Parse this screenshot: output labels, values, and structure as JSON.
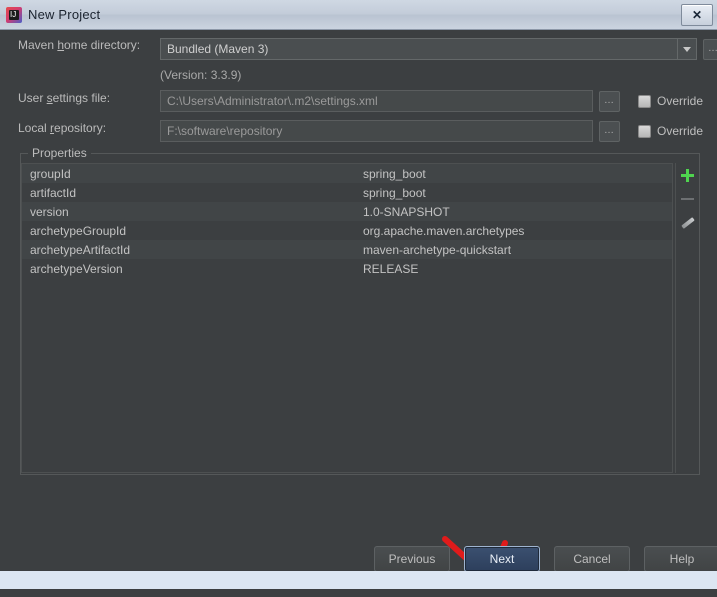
{
  "window": {
    "title": "New Project",
    "app_icon": "intellij-idea-icon",
    "close_label": "✕"
  },
  "form": {
    "maven_home": {
      "label_pre": "Maven ",
      "label_mnemonic": "h",
      "label_post": "ome directory:",
      "value": "Bundled (Maven 3)",
      "browse_label": "…",
      "version_note": "(Version: 3.3.9)"
    },
    "user_settings": {
      "label_pre": "User ",
      "label_mnemonic": "s",
      "label_post": "ettings file:",
      "value": "C:\\Users\\Administrator\\.m2\\settings.xml",
      "browse_label": "…",
      "override_label": "Override",
      "override_checked": false
    },
    "local_repository": {
      "label_pre": "Local ",
      "label_mnemonic": "r",
      "label_post": "epository:",
      "value": "F:\\software\\repository",
      "browse_label": "…",
      "override_label": "Override",
      "override_checked": false
    }
  },
  "properties": {
    "group_title": "Properties",
    "rows": [
      {
        "key": "groupId",
        "value": "spring_boot"
      },
      {
        "key": "artifactId",
        "value": "spring_boot"
      },
      {
        "key": "version",
        "value": "1.0-SNAPSHOT"
      },
      {
        "key": "archetypeGroupId",
        "value": "org.apache.maven.archetypes"
      },
      {
        "key": "archetypeArtifactId",
        "value": "maven-archetype-quickstart"
      },
      {
        "key": "archetypeVersion",
        "value": "RELEASE"
      }
    ],
    "toolbar": {
      "add": "add-property",
      "remove": "remove-property",
      "edit": "edit-property"
    }
  },
  "buttons": {
    "previous": "Previous",
    "next": "Next",
    "cancel": "Cancel",
    "help": "Help"
  },
  "colors": {
    "window_bg": "#3c3f41",
    "field_bg": "#45494a",
    "accent_add": "#4fd44f",
    "primary_button": "#3b5070",
    "annotation_arrow": "#e01b1b",
    "titlebar": "#c3ccd9"
  }
}
